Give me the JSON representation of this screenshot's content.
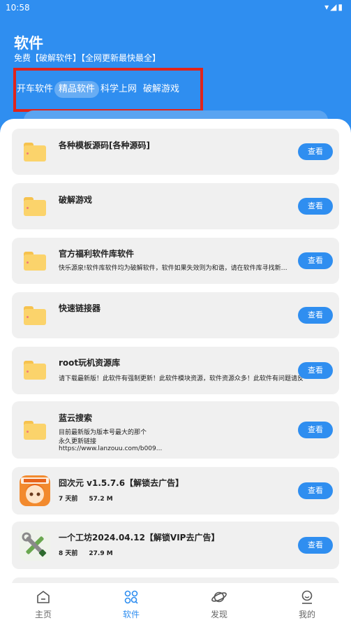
{
  "status_bar": {
    "time": "10:58",
    "icons": "▾◢▮"
  },
  "header": {
    "title": "软件",
    "subtitle": "免费【破解软件】【全网更新最快最全】"
  },
  "tabs": [
    {
      "label": "开车软件",
      "active": false
    },
    {
      "label": "精品软件",
      "active": true
    },
    {
      "label": "科学上网",
      "active": false
    },
    {
      "label": "破解游戏",
      "active": false
    }
  ],
  "items": [
    {
      "title": "各种模板源码[各种源码]",
      "desc": [],
      "button": "查看"
    },
    {
      "title": "破解游戏",
      "desc": [],
      "button": "查看"
    },
    {
      "title": "官方福利软件库软件",
      "desc": [
        "快乐源泉!软件库软件均为破解软件，软件如果失效则为和谐，请在软件库寻找新版..."
      ],
      "button": "查看"
    },
    {
      "title": "快速链接器",
      "desc": [],
      "button": "查看"
    },
    {
      "title": "root玩机资源库",
      "desc": [
        "请下载最新版！此软件有强制更新！此软件模块资源，软件资源众多！此软件有问题请反"
      ],
      "button": "查看"
    },
    {
      "title": "蓝云搜索",
      "desc": [
        "目前最新版为版本号最大的那个",
        "永久更新链接",
        "https://www.lanzouu.com/b009..."
      ],
      "button": "查看"
    },
    {
      "title": "囧次元 v1.5.7.6【解锁去广告】",
      "time": "7 天前",
      "size": "57.2 M",
      "button": "查看"
    },
    {
      "title": "一个工坊2024.04.12【解锁VIP去广告】",
      "time": "8 天前",
      "size": "27.9 M",
      "button": "查看"
    }
  ],
  "bottom_nav": [
    {
      "label": "主页",
      "icon": "home-icon",
      "active": false
    },
    {
      "label": "软件",
      "icon": "apps-icon",
      "active": true
    },
    {
      "label": "发现",
      "icon": "planet-icon",
      "active": false
    },
    {
      "label": "我的",
      "icon": "profile-icon",
      "active": false
    }
  ],
  "colors": {
    "primary": "#2f8ef0",
    "highlight_box": "#e0241b",
    "card_bg": "#f0f0f0",
    "folder": "#fbd36b"
  }
}
